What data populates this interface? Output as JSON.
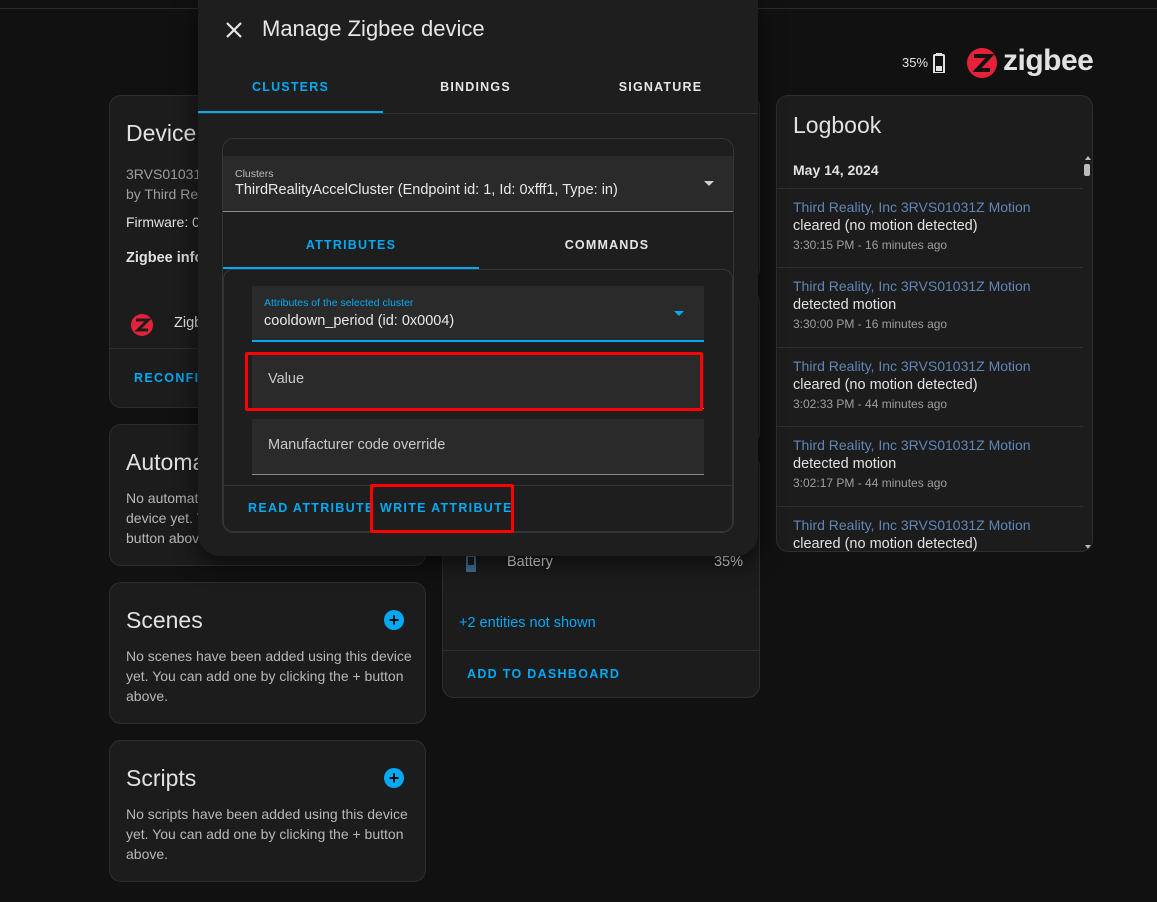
{
  "header": {
    "battery_pct": "35%",
    "brand": "zigbee"
  },
  "colors": {
    "accent": "#03a9f4",
    "highlight": "#ff0000",
    "zigbee_red": "#e6223b"
  },
  "device_card": {
    "title": "Device",
    "model": "3RVS01031",
    "manufacturer": "by Third Rea",
    "firmware": "Firmware: 0",
    "zigbee_info": "Zigbee info",
    "zigbee_row": "Zigb",
    "reconfigure": "RECONFIG"
  },
  "automations_card": {
    "title": "Automa",
    "text1": "No automat",
    "text2": "device yet. Y",
    "text3": "button abov"
  },
  "scenes_card": {
    "title": "Scenes",
    "text1": "No scenes have been added using this device",
    "text2": "yet. You can add one by clicking the + button",
    "text3": "above."
  },
  "scripts_card": {
    "title": "Scripts",
    "text1": "No scripts have been added using this device",
    "text2": "yet. You can add one by clicking the + button",
    "text3": "above."
  },
  "entities_card": {
    "battery_label": "Battery",
    "battery_value": "35%",
    "hidden_entities": "+2 entities not shown",
    "add_to_dashboard": "ADD TO DASHBOARD"
  },
  "logbook": {
    "title": "Logbook",
    "date": "May 14, 2024",
    "entries": [
      {
        "entity": "Third Reality, Inc 3RVS01031Z Motion",
        "message": "cleared (no motion detected)",
        "time": "3:30:15 PM - 16 minutes ago"
      },
      {
        "entity": "Third Reality, Inc 3RVS01031Z Motion",
        "message": "detected motion",
        "time": "3:30:00 PM - 16 minutes ago"
      },
      {
        "entity": "Third Reality, Inc 3RVS01031Z Motion",
        "message": "cleared (no motion detected)",
        "time": "3:02:33 PM - 44 minutes ago"
      },
      {
        "entity": "Third Reality, Inc 3RVS01031Z Motion",
        "message": "detected motion",
        "time": "3:02:17 PM - 44 minutes ago"
      },
      {
        "entity": "Third Reality, Inc 3RVS01031Z Motion",
        "message": "cleared (no motion detected)",
        "time": ""
      }
    ]
  },
  "dialog": {
    "title": "Manage Zigbee device",
    "tabs": [
      "CLUSTERS",
      "BINDINGS",
      "SIGNATURE"
    ],
    "active_tab": "CLUSTERS",
    "cluster_select": {
      "label": "Clusters",
      "value": "ThirdRealityAccelCluster (Endpoint id: 1, Id: 0xfff1, Type: in)"
    },
    "sub_tabs": [
      "ATTRIBUTES",
      "COMMANDS"
    ],
    "active_sub_tab": "ATTRIBUTES",
    "attribute_select": {
      "label": "Attributes of the selected cluster",
      "value": "cooldown_period (id: 0x0004)"
    },
    "value_field": {
      "label": "Value"
    },
    "manufacturer_field": {
      "label": "Manufacturer code override"
    },
    "read_button": "READ ATTRIBUTE",
    "write_button": "WRITE ATTRIBUTE"
  }
}
